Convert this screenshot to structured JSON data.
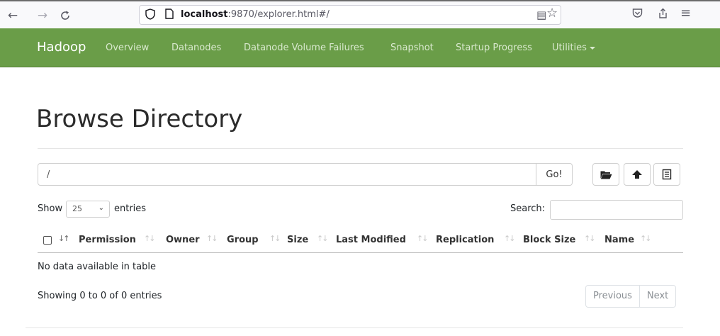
{
  "browser": {
    "back_icon": "←",
    "forward_icon": "→",
    "reload_icon": "C",
    "url_host": "localhost",
    "url_rest": ":9870/explorer.html#/",
    "reader_icon": "▤",
    "bookmark_icon": "☆",
    "pocket_icon": "♡",
    "share_icon": "⇪",
    "menu_icon": "≡"
  },
  "navbar": {
    "brand": "Hadoop",
    "links": [
      "Overview",
      "Datanodes",
      "Datanode Volume Failures",
      "Snapshot",
      "Startup Progress",
      "Utilities"
    ],
    "background": "#6a9d48"
  },
  "page": {
    "title": "Browse Directory",
    "path_value": "/",
    "go_label": "Go!",
    "toolbar_icons": [
      "folder-icon",
      "upload-icon",
      "cut-icon"
    ]
  },
  "table_controls": {
    "show_label": "Show",
    "page_length": "25",
    "entries_label": "entries",
    "search_label": "Search:",
    "search_value": ""
  },
  "table": {
    "columns": [
      "Permission",
      "Owner",
      "Group",
      "Size",
      "Last Modified",
      "Replication",
      "Block Size",
      "Name"
    ],
    "empty_message": "No data available in table",
    "info": "Showing 0 to 0 of 0 entries",
    "previous_label": "Previous",
    "next_label": "Next"
  }
}
